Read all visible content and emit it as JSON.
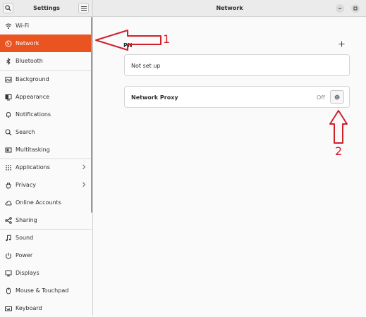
{
  "sidebar": {
    "title": "Settings",
    "items": [
      {
        "label": "Wi-Fi",
        "icon": "wifi-icon"
      },
      {
        "label": "Network",
        "icon": "network-icon",
        "active": true
      },
      {
        "label": "Bluetooth",
        "icon": "bluetooth-icon"
      },
      {
        "label": "Background",
        "icon": "background-icon"
      },
      {
        "label": "Appearance",
        "icon": "appearance-icon"
      },
      {
        "label": "Notifications",
        "icon": "bell-icon"
      },
      {
        "label": "Search",
        "icon": "search-icon"
      },
      {
        "label": "Multitasking",
        "icon": "multitasking-icon"
      },
      {
        "label": "Applications",
        "icon": "grid-icon",
        "chevron": true
      },
      {
        "label": "Privacy",
        "icon": "hand-icon",
        "chevron": true
      },
      {
        "label": "Online Accounts",
        "icon": "cloud-icon"
      },
      {
        "label": "Sharing",
        "icon": "share-icon"
      },
      {
        "label": "Sound",
        "icon": "music-note-icon"
      },
      {
        "label": "Power",
        "icon": "power-icon"
      },
      {
        "label": "Displays",
        "icon": "display-icon"
      },
      {
        "label": "Mouse & Touchpad",
        "icon": "mouse-icon"
      },
      {
        "label": "Keyboard",
        "icon": "keyboard-icon"
      }
    ]
  },
  "header": {
    "title": "Network"
  },
  "main": {
    "vpn_label": "PN",
    "vpn_status": "Not set up",
    "proxy_label": "Network Proxy",
    "proxy_status": "Off"
  },
  "annotations": {
    "arrow1_label": "1",
    "arrow2_label": "2"
  },
  "colors": {
    "accent": "#e95420",
    "annotation": "#d0202a"
  }
}
